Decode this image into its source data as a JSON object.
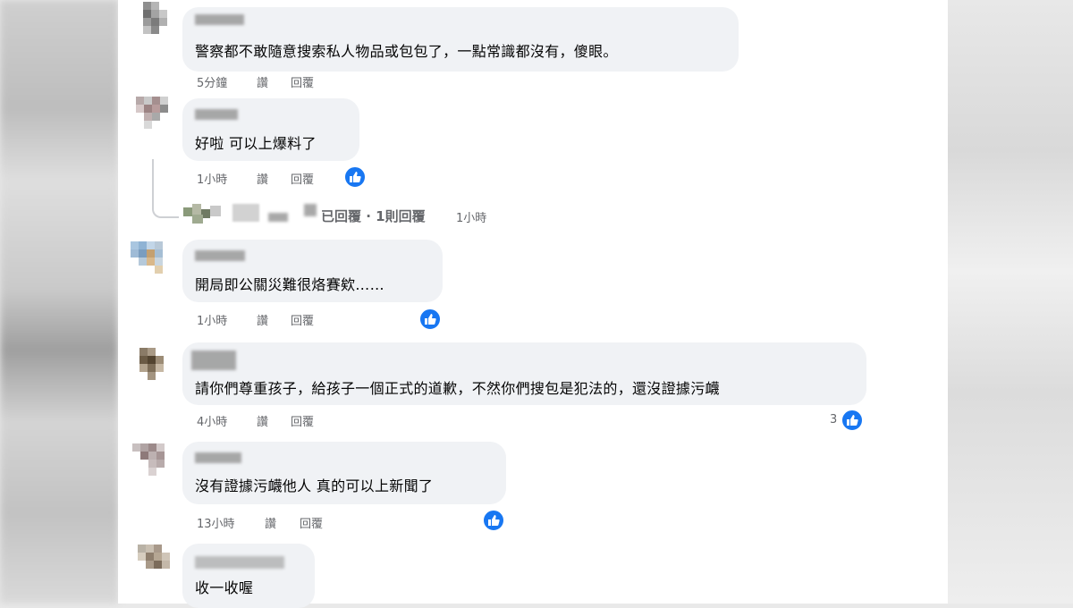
{
  "comments": [
    {
      "text": "警察都不敢隨意搜索私人物品或包包了，一點常識都沒有，傻眼。",
      "time": "5分鐘",
      "like_label": "讚",
      "reply_label": "回覆"
    },
    {
      "text": "好啦 可以上爆料了",
      "time": "1小時",
      "like_label": "讚",
      "reply_label": "回覆",
      "has_reaction": true,
      "replies_summary": "已回覆 · 1則回覆",
      "replies_time": "1小時"
    },
    {
      "text": "開局即公關災難很烙賽欸……",
      "time": "1小時",
      "like_label": "讚",
      "reply_label": "回覆",
      "has_reaction": true
    },
    {
      "text": "請你們尊重孩子，給孩子一個正式的道歉，不然你們搜包是犯法的，還沒證據污衊",
      "time": "4小時",
      "like_label": "讚",
      "reply_label": "回覆",
      "reaction_count": "3"
    },
    {
      "text": "沒有證據污衊他人 真的可以上新聞了",
      "time": "13小時",
      "like_label": "讚",
      "reply_label": "回覆",
      "has_reaction": true
    },
    {
      "text": "收一收喔"
    }
  ],
  "icons": {
    "reaction": "thumbs-up-icon",
    "accent": "#1877f2"
  }
}
